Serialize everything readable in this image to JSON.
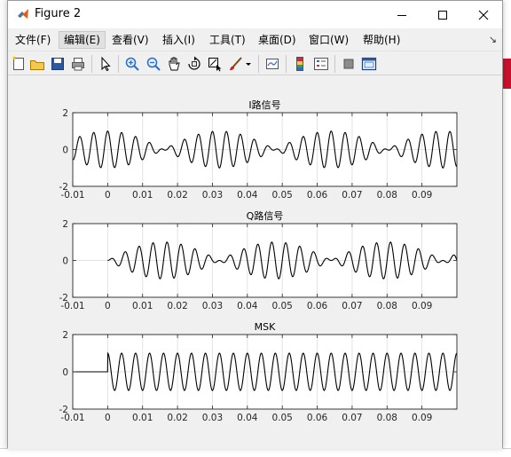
{
  "window": {
    "title": "Figure 2",
    "minimize_icon": "minimize-icon",
    "maximize_icon": "maximize-icon",
    "close_icon": "close-icon"
  },
  "menu": [
    {
      "label": "文件(F)"
    },
    {
      "label": "编辑(E)"
    },
    {
      "label": "查看(V)"
    },
    {
      "label": "插入(I)"
    },
    {
      "label": "工具(T)"
    },
    {
      "label": "桌面(D)"
    },
    {
      "label": "窗口(W)"
    },
    {
      "label": "帮助(H)"
    }
  ],
  "menu_active_index": 1,
  "toolbar_icons": [
    "new-figure-icon",
    "open-file-icon",
    "save-icon",
    "print-icon",
    "pointer-icon",
    "zoom-in-icon",
    "zoom-out-icon",
    "pan-icon",
    "rotate-3d-icon",
    "data-cursor-icon",
    "brush-icon",
    "link-plot-icon",
    "colorbar-icon",
    "legend-icon",
    "hide-plot-tools-icon",
    "show-plot-tools-icon"
  ],
  "chart_data": [
    {
      "type": "line",
      "title": "I路信号",
      "xlabel": "",
      "ylabel": "",
      "xlim": [
        -0.01,
        0.1
      ],
      "ylim": [
        -2,
        2
      ],
      "xticks": [
        -0.01,
        0,
        0.01,
        0.02,
        0.03,
        0.04,
        0.05,
        0.06,
        0.07,
        0.08,
        0.09
      ],
      "xtick_labels": [
        "-0.01",
        "0",
        "0.01",
        "0.02",
        "0.03",
        "0.04",
        "0.05",
        "0.06",
        "0.07",
        "0.08",
        "0.09"
      ],
      "yticks": [
        -2,
        0,
        2
      ],
      "ytick_labels": [
        "-2",
        "0",
        "2"
      ],
      "grid": true,
      "series": [
        {
          "color": "#000000",
          "x": [
            -0.01,
            0.1
          ],
          "y_range": [
            -1,
            1
          ],
          "formula": "cos(pi*t/(2*Tb)) * cos(2*pi*fc*t)"
        }
      ]
    },
    {
      "type": "line",
      "title": "Q路信号",
      "xlabel": "",
      "ylabel": "",
      "xlim": [
        -0.01,
        0.1
      ],
      "ylim": [
        -2,
        2
      ],
      "xticks": [
        -0.01,
        0,
        0.01,
        0.02,
        0.03,
        0.04,
        0.05,
        0.06,
        0.07,
        0.08,
        0.09
      ],
      "xtick_labels": [
        "-0.01",
        "0",
        "0.01",
        "0.02",
        "0.03",
        "0.04",
        "0.05",
        "0.06",
        "0.07",
        "0.08",
        "0.09"
      ],
      "yticks": [
        -2,
        0,
        2
      ],
      "ytick_labels": [
        "-2",
        "0",
        "2"
      ],
      "grid": true,
      "series": [
        {
          "color": "#000000",
          "x": [
            0,
            0.1
          ],
          "y_range": [
            -1,
            1
          ],
          "formula": "sin(pi*t/(2*Tb)) * sin(2*pi*fc*t)"
        }
      ]
    },
    {
      "type": "line",
      "title": "MSK",
      "xlabel": "",
      "ylabel": "",
      "xlim": [
        -0.01,
        0.1
      ],
      "ylim": [
        -2,
        2
      ],
      "xticks": [
        -0.01,
        0,
        0.01,
        0.02,
        0.03,
        0.04,
        0.05,
        0.06,
        0.07,
        0.08,
        0.09
      ],
      "xtick_labels": [
        "-0.01",
        "0",
        "0.01",
        "0.02",
        "0.03",
        "0.04",
        "0.05",
        "0.06",
        "0.07",
        "0.08",
        "0.09"
      ],
      "yticks": [
        -2,
        0,
        2
      ],
      "ytick_labels": [
        "-2",
        "0",
        "2"
      ],
      "grid": true,
      "series": [
        {
          "color": "#000000",
          "x": [
            -0.01,
            0.1
          ],
          "y_range": [
            -1,
            1
          ],
          "formula": "0 for t<0; cos(2*pi*fc*t) for t>=0"
        }
      ]
    }
  ]
}
